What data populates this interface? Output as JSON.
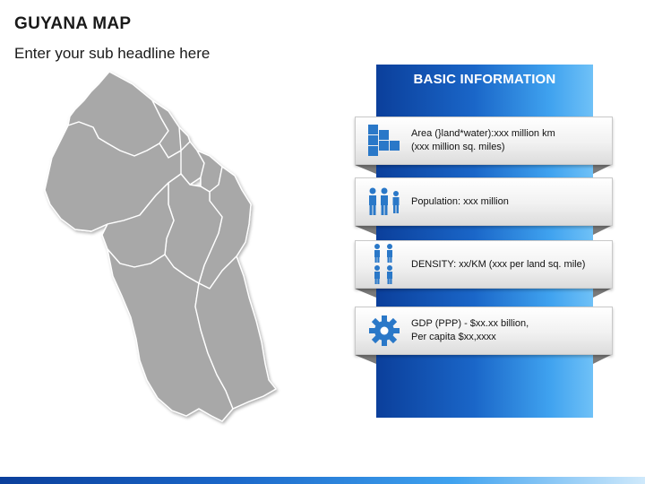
{
  "slide": {
    "title": "GUYANA MAP",
    "subtitle": "Enter your sub headline here"
  },
  "info_panel": {
    "header": "BASIC INFORMATION",
    "items": [
      {
        "icon": "area-grid-icon",
        "line1": "Area (}land*water):xxx million km",
        "line2": "(xxx million sq. miles)"
      },
      {
        "icon": "population-people-icon",
        "line1": "Population: xxx million",
        "line2": ""
      },
      {
        "icon": "density-people-icon",
        "line1": "DENSITY: xx/KM (xxx per land sq. mile)",
        "line2": ""
      },
      {
        "icon": "gear-icon",
        "line1": "GDP (PPP) - $xx.xx billion,",
        "line2": "Per capita $xx,xxxx"
      }
    ]
  },
  "colors": {
    "map_fill": "#a8a8a8",
    "map_border": "#ffffff",
    "accent_blue": "#1a66c8",
    "icon_blue": "#2a78c8"
  }
}
